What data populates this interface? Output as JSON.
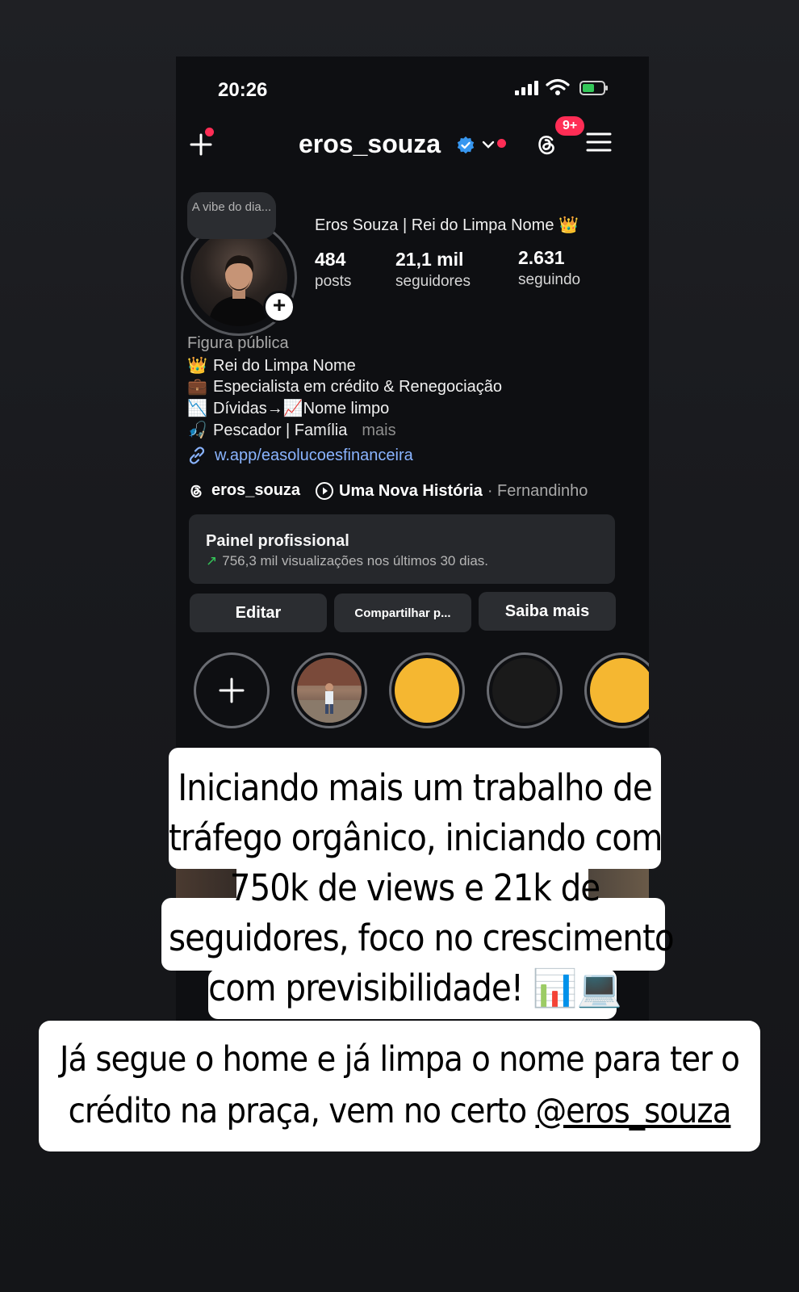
{
  "status": {
    "time": "20:26"
  },
  "header": {
    "username": "eros_souza",
    "notification_badge": "9+"
  },
  "profile": {
    "note": "A vibe do dia...",
    "full_name": "Eros Souza | Rei do Limpa Nome 👑",
    "stats": [
      {
        "value": "484",
        "label": "posts"
      },
      {
        "value": "21,1 mil",
        "label": "seguidores"
      },
      {
        "value": "2.631",
        "label": "seguindo"
      }
    ],
    "category": "Figura pública",
    "bio": [
      {
        "emoji": "👑",
        "text": "Rei do Limpa Nome"
      },
      {
        "emoji": "💼",
        "text": "Especialista em crédito & Renegociação"
      },
      {
        "emoji": "📉",
        "text": "Dívidas→📈Nome limpo"
      },
      {
        "emoji": "🎣",
        "text": "Pescador | Família"
      }
    ],
    "more_label": "mais",
    "link": "w.app/easolucoesfinanceira",
    "threads_handle": "eros_souza",
    "song_title": "Uma Nova História",
    "song_artist": "· Fernandinho"
  },
  "panel": {
    "title": "Painel profissional",
    "subtitle": "756,3 mil visualizações nos últimos 30 dias."
  },
  "buttons": {
    "edit": "Editar",
    "share": "Compartilhar p...",
    "learn": "Saiba mais"
  },
  "highlights": [
    {
      "type": "new",
      "color": "#0e0f12"
    },
    {
      "type": "photo",
      "color": "#8a6a58"
    },
    {
      "type": "solid",
      "color": "#f5b731"
    },
    {
      "type": "solid",
      "color": "#1a1a1a"
    },
    {
      "type": "solid",
      "color": "#f5b731"
    }
  ],
  "captions": {
    "first": [
      "Iniciando mais um trabalho de",
      "tráfego orgânico, iniciando com",
      "750k de views e 21k de",
      "seguidores, foco no crescimento",
      "com previsibilidade! 📊💻"
    ],
    "second_line1": "Já segue o home e já limpa o nome para ter o",
    "second_line2_prefix": "crédito na praça, vem no certo ",
    "mention": "@eros_souza"
  }
}
